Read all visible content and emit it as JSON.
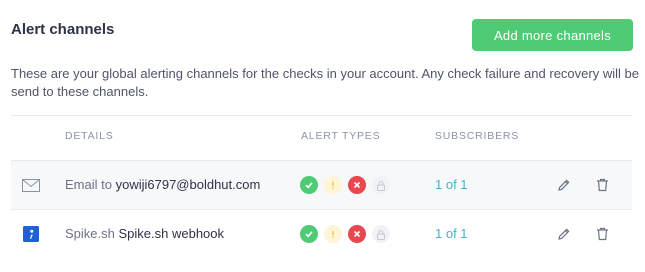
{
  "header": {
    "title": "Alert channels",
    "add_button_label": "Add more channels",
    "description": "These are your global alerting channels for the checks in your account. Any check failure and recovery will be send to these channels."
  },
  "table": {
    "columns": [
      "DETAILS",
      "ALERT TYPES",
      "SUBSCRIBERS"
    ],
    "rows": [
      {
        "channel_type_icon": "envelope-icon",
        "type_label": "Email to",
        "target": "yowiji6797@boldhut.com",
        "alert_types": [
          "success",
          "degraded",
          "failure",
          "locked"
        ],
        "subscribers": "1 of 1"
      },
      {
        "channel_type_icon": "spike-logo-icon",
        "type_label": "Spike.sh",
        "target": "Spike.sh webhook",
        "alert_types": [
          "success",
          "degraded",
          "failure",
          "locked"
        ],
        "subscribers": "1 of 1"
      }
    ]
  },
  "colors": {
    "accent_green": "#4fcb76",
    "error_red": "#e8474f",
    "warning_yellow": "#f0c14b",
    "link_teal": "#3fb5c8"
  }
}
